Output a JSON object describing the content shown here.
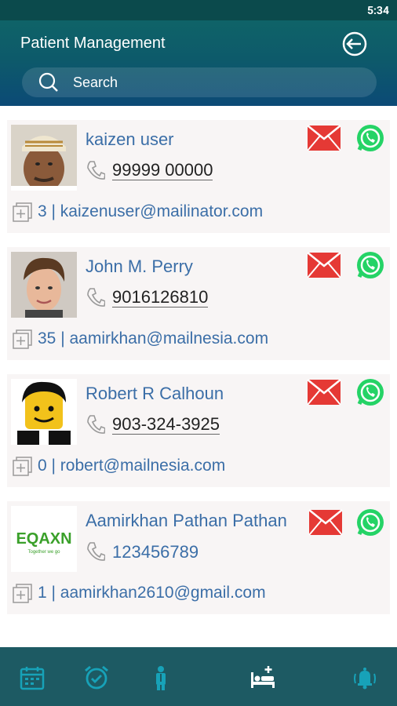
{
  "status_bar": {
    "time": "5:34"
  },
  "header": {
    "title": "Patient Management",
    "logout_icon": "logout-icon"
  },
  "search": {
    "placeholder": "Search"
  },
  "patients": [
    {
      "name": "kaizen user",
      "phone": "99999 00000",
      "info": "3 | kaizenuser@mailinator.com",
      "avatar": "man-with-cap-photo"
    },
    {
      "name": "John M. Perry",
      "phone": "9016126810",
      "info": "35 | aamirkhan@mailnesia.com",
      "avatar": "man-portrait-photo"
    },
    {
      "name": "Robert R Calhoun",
      "phone": "903-324-3925",
      "info": "0 | robert@mailnesia.com",
      "avatar": "lego-figure-photo"
    },
    {
      "name": "Aamirkhan Pathan Pathan",
      "phone": "123456789",
      "info": "1 | aamirkhan2610@gmail.com",
      "avatar": "company-logo",
      "logo_text": "EQAXN",
      "logo_tagline": "Together we go"
    }
  ],
  "nav": [
    {
      "icon": "calendar-icon"
    },
    {
      "icon": "alarm-clock-icon"
    },
    {
      "icon": "doctor-icon"
    },
    {
      "icon": "hospital-bed-icon",
      "active": true
    },
    {
      "icon": "bell-ringing-icon"
    }
  ],
  "colors": {
    "header_top": "#0f6368",
    "header_bottom": "#0c4a76",
    "name_blue": "#3b6ea7",
    "mail_red": "#e53935",
    "whatsapp_green": "#25d366",
    "nav_bg": "#1d5a63",
    "nav_icon": "#17a2b8"
  }
}
